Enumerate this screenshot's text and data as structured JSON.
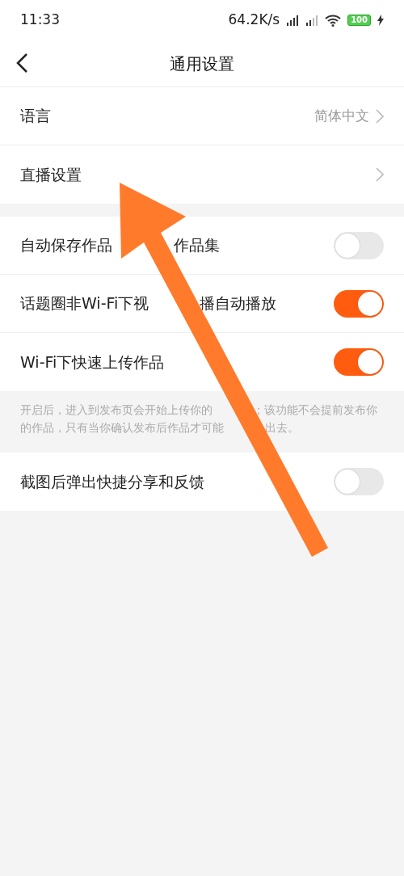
{
  "status_bar": {
    "time": "11:33",
    "speed": "64.2K/s",
    "battery": "100"
  },
  "header": {
    "title": "通用设置"
  },
  "nav_rows": [
    {
      "label": "语言",
      "value": "简体中文"
    },
    {
      "label": "直播设置"
    }
  ],
  "toggle_rows": [
    {
      "label_parts": [
        "自动保存作品",
        "作品集"
      ],
      "on": false
    },
    {
      "label_parts": [
        "话题圈非Wi-Fi下视",
        "播自动播放"
      ],
      "on": true
    },
    {
      "label_parts": [
        "Wi-Fi下快速上传作品"
      ],
      "on": true
    }
  ],
  "note": {
    "lines": [
      [
        "开启后，进入到发布页会开始上传你的",
        "；该功能不会提前发布你"
      ],
      [
        "的作品，只有当你确认发布后作品才可能",
        "出去。"
      ]
    ]
  },
  "extra_rows": [
    {
      "label_parts": [
        "截图后弹出快捷分享和反馈"
      ],
      "on": false
    }
  ]
}
